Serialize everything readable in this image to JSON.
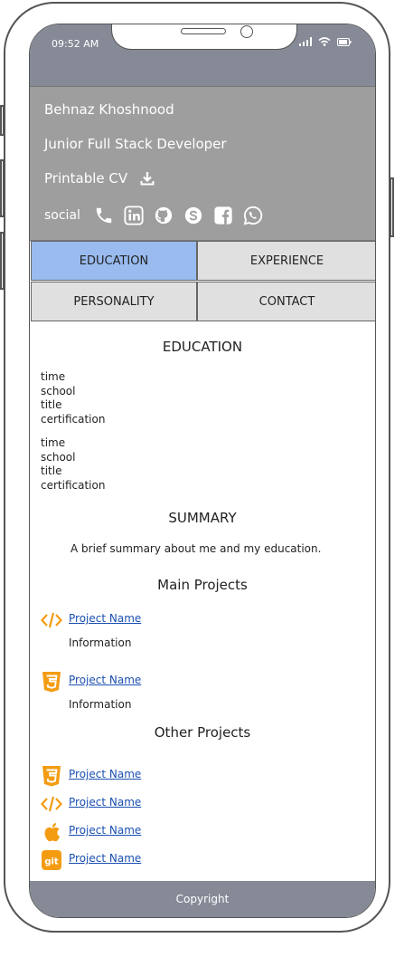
{
  "status_bar": {
    "time": "09:52 AM",
    "icons": [
      "signal-icon",
      "wifi-icon",
      "battery-icon"
    ]
  },
  "header": {
    "name": "Behnaz Khoshnood",
    "role": "Junior Full Stack Developer",
    "cv_label": "Printable CV",
    "social_label": "social",
    "social_icons": [
      "phone-icon",
      "linkedin-icon",
      "github-icon",
      "skype-icon",
      "facebook-icon",
      "whatsapp-icon"
    ]
  },
  "tabs": [
    {
      "label": "EDUCATION",
      "active": true
    },
    {
      "label": "EXPERIENCE",
      "active": false
    },
    {
      "label": "PERSONALITY",
      "active": false
    },
    {
      "label": "CONTACT",
      "active": false
    }
  ],
  "education": {
    "title": "EDUCATION",
    "entries": [
      {
        "time": "time",
        "school": "school",
        "title": "title",
        "certification": "certification"
      },
      {
        "time": "time",
        "school": "school",
        "title": "title",
        "certification": "certification"
      }
    ]
  },
  "summary": {
    "title": "SUMMARY",
    "text": "A brief summary about me and my education."
  },
  "main_projects": {
    "title": "Main Projects",
    "items": [
      {
        "icon": "code-icon",
        "name": "Project Name",
        "info": "Information"
      },
      {
        "icon": "css3-icon",
        "name": "Project Name",
        "info": "Information"
      }
    ]
  },
  "other_projects": {
    "title": "Other Projects",
    "items": [
      {
        "icon": "css3-icon",
        "name": "Project Name"
      },
      {
        "icon": "code-icon",
        "name": "Project Name"
      },
      {
        "icon": "apple-icon",
        "name": "Project Name"
      },
      {
        "icon": "git-icon",
        "name": "Project Name"
      }
    ]
  },
  "footer": {
    "text": "Copyright"
  },
  "colors": {
    "status_bar": "#858a96",
    "header_bg": "#9e9e9e",
    "tab_active": "#99bbf0",
    "tab_inactive": "#e0e0e0",
    "icon_orange": "#f39c12",
    "link": "#1a4fb0"
  }
}
